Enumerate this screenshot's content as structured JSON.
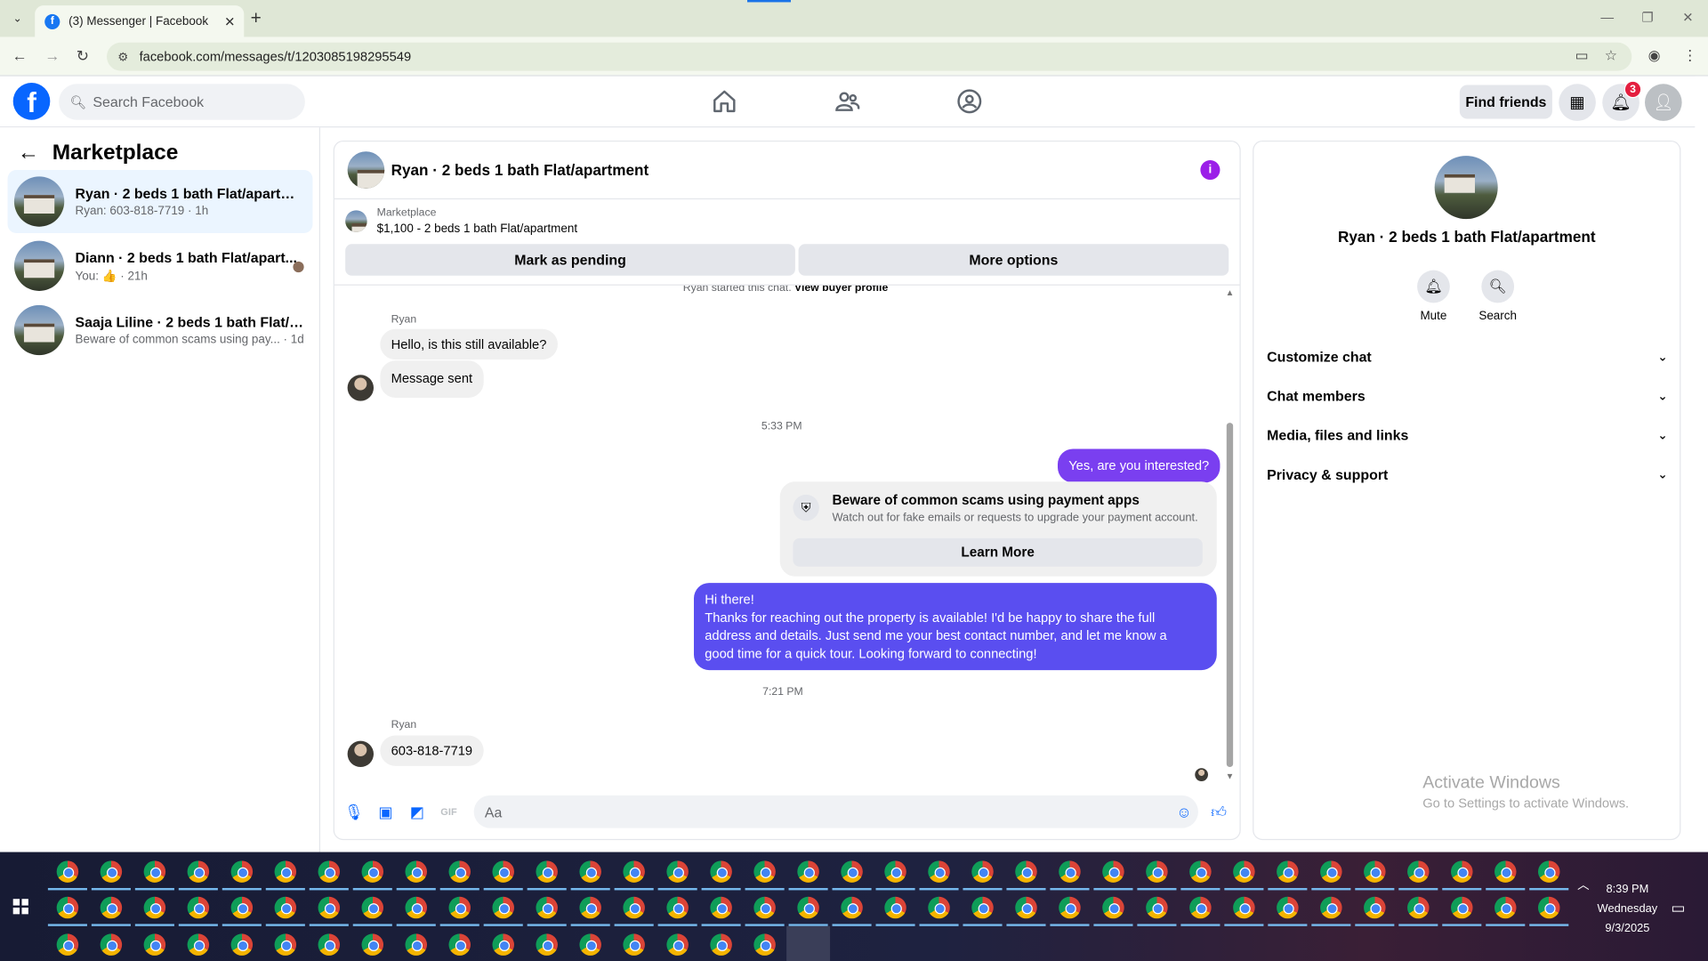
{
  "browser": {
    "tab_title": "(3) Messenger | Facebook",
    "tab_favicon": "facebook-icon",
    "url": "facebook.com/messages/t/1203085198295549",
    "controls": {
      "minimize": "—",
      "restore": "❐",
      "close": "✕"
    }
  },
  "header": {
    "search_placeholder": "Search Facebook",
    "find_friends": "Find friends",
    "notification_count": "3",
    "brand_color": "#0866ff"
  },
  "sidebar": {
    "title": "Marketplace",
    "conversations": [
      {
        "name": "Ryan · 2 beds 1 bath Flat/apartment",
        "preview": "Ryan: 603-818-7719 · 1h",
        "active": true
      },
      {
        "name": "Diann · 2 beds 1 bath Flat/apart...",
        "preview": "You: 👍 · 21h",
        "active": false
      },
      {
        "name": "Saaja Liline · 2 beds 1 bath Flat/ap...",
        "preview": "Beware of common scams using pay... · 1d",
        "active": false
      }
    ]
  },
  "chat": {
    "title": "Ryan · 2 beds 1 bath Flat/apartment",
    "marketplace_label": "Marketplace",
    "listing": "$1,100 - 2 beds 1 bath Flat/apartment",
    "mark_pending": "Mark as pending",
    "more_options": "More options",
    "started_text": "Ryan started this chat.",
    "view_buyer": "View buyer profile",
    "sender_1": "Ryan",
    "msg_1": "Hello, is this still available?",
    "msg_2": "Message sent",
    "time_1": "5:33 PM",
    "out_1": "Yes, are you interested?",
    "scam_title": "Beware of common scams using payment apps",
    "scam_sub": "Watch out for fake emails or requests to upgrade your payment account.",
    "learn_more": "Learn More",
    "out_2_lines": [
      "Hi there!",
      "Thanks for reaching out the property is available! I'd be happy to share the full",
      "address and details. Just send me your best contact number, and let me know a",
      "good time for a quick tour. Looking forward to connecting!"
    ],
    "time_2": "7:21 PM",
    "sender_2": "Ryan",
    "msg_3": "603-818-7719",
    "compose_placeholder": "Aa",
    "outgoing_color": "#7a3ff0"
  },
  "details": {
    "title": "Ryan · 2 beds 1 bath Flat/apartment",
    "mute": "Mute",
    "search": "Search",
    "sections": [
      "Customize chat",
      "Chat members",
      "Media, files and links",
      "Privacy & support"
    ]
  },
  "watermark": {
    "line1": "Activate Windows",
    "line2": "Go to Settings to activate Windows."
  },
  "taskbar": {
    "time": "8:39 PM",
    "day": "Wednesday",
    "date": "9/3/2025"
  }
}
